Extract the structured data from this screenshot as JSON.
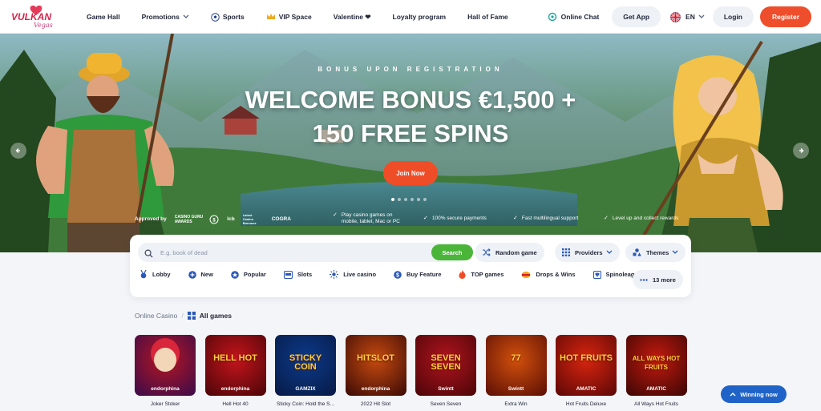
{
  "brand": {
    "logo_text": "VULKAN",
    "logo_sub": "Vegas",
    "accent": "#ee4e2b",
    "green": "#4bb53a",
    "blue": "#1f63c8"
  },
  "nav": {
    "items": [
      {
        "label": "Game Hall",
        "icon": ""
      },
      {
        "label": "Promotions",
        "icon": "",
        "has_dropdown": true
      },
      {
        "label": "Sports",
        "icon": "soccer-ball-icon"
      },
      {
        "label": "VIP Space",
        "icon": "crown-icon"
      },
      {
        "label": "Valentine ❤",
        "icon": ""
      },
      {
        "label": "Loyalty program",
        "icon": ""
      },
      {
        "label": "Hall of Fame",
        "icon": ""
      }
    ],
    "online_chat": "Online Chat",
    "get_app": "Get App",
    "language": "EN",
    "login": "Login",
    "register": "Register"
  },
  "hero": {
    "subtitle": "BONUS UPON REGISTRATION",
    "title_line1": "WELCOME BONUS €1,500 +",
    "title_line2": "150 FREE SPINS",
    "cta": "Join Now",
    "slides_count": 6,
    "active_slide": 1,
    "approved_label": "Approved by",
    "award_line1": "CASINO GURU",
    "award_line2": "AWARDS",
    "badges": [
      "lcb",
      "Latest Casino Bonuses",
      "COGRA"
    ],
    "features": [
      {
        "line1": "Play casino games on",
        "line2": "mobile, tablet, Mac or PC"
      },
      {
        "line1": "100% secure payments",
        "line2": ""
      },
      {
        "line1": "Fast multilingual support",
        "line2": ""
      },
      {
        "line1": "Level up and collect rewards",
        "line2": ""
      }
    ]
  },
  "search": {
    "placeholder": "E.g. book of dead",
    "button": "Search",
    "random_game": "Random game",
    "providers": "Providers",
    "themes": "Themes"
  },
  "categories": [
    {
      "label": "Lobby",
      "icon": "medal-icon"
    },
    {
      "label": "New",
      "icon": "plus-circle-icon"
    },
    {
      "label": "Popular",
      "icon": "star-circle-icon"
    },
    {
      "label": "Slots",
      "icon": "slot-machine-icon"
    },
    {
      "label": "Live casino",
      "icon": "live-icon"
    },
    {
      "label": "Buy Feature",
      "icon": "coin-icon"
    },
    {
      "label": "TOP games",
      "icon": "fire-icon"
    },
    {
      "label": "Drops & Wins",
      "icon": "drops-wins-icon"
    },
    {
      "label": "Spinoleague",
      "icon": "trophy-card-icon"
    }
  ],
  "more_label": "13 more",
  "games_section": {
    "crumb_parent": "Online Casino",
    "crumb_current": "All games"
  },
  "games": [
    {
      "name": "Joker Stoker",
      "provider": "endorphina",
      "art_text": "",
      "bg1": "#b51622",
      "bg2": "#3a0b4a"
    },
    {
      "name": "Hell Hot 40",
      "provider": "endorphina",
      "art_text": "HELL HOT",
      "bg1": "#c4151c",
      "bg2": "#4a0508"
    },
    {
      "name": "Sticky Coin: Hold the S...",
      "provider": "GAMZIX",
      "art_text": "STICKY COIN",
      "bg1": "#0c3a8a",
      "bg2": "#071a45"
    },
    {
      "name": "2022 Hit Slot",
      "provider": "endorphina",
      "art_text": "HITSLOT",
      "bg1": "#c64a10",
      "bg2": "#3b0a05"
    },
    {
      "name": "Seven Seven",
      "provider": "Swintt",
      "art_text": "SEVEN SEVEN",
      "bg1": "#b0141e",
      "bg2": "#4a0508"
    },
    {
      "name": "Extra Win",
      "provider": "Swintt",
      "art_text": "77",
      "bg1": "#d2500c",
      "bg2": "#5a0e05"
    },
    {
      "name": "Hot Fruits Deluxe",
      "provider": "AMATIC",
      "art_text": "HOT FRUITS",
      "bg1": "#d8250f",
      "bg2": "#5b0706"
    },
    {
      "name": "All Ways Hot Fruits",
      "provider": "AMATIC",
      "art_text": "ALL WAYS HOT FRUITS",
      "bg1": "#c31a0f",
      "bg2": "#3c0604"
    }
  ],
  "winning_now": "Winning now"
}
